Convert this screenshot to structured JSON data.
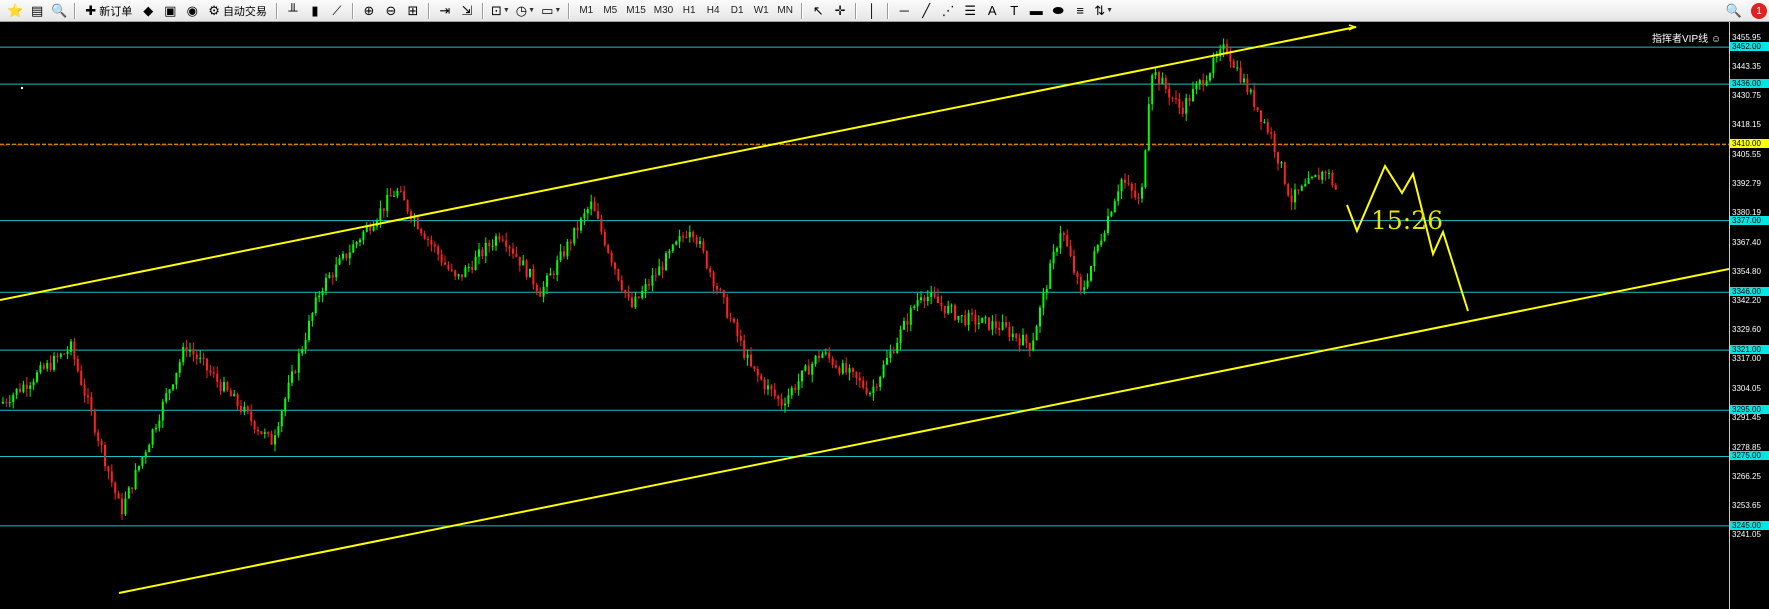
{
  "toolbar": {
    "new_order": "新订单",
    "auto_trading": "自动交易",
    "timeframes": [
      "M1",
      "M5",
      "M15",
      "M30",
      "H1",
      "H4",
      "D1",
      "W1",
      "MN"
    ],
    "alert_count": "1"
  },
  "watermark": "指挥者VIP线",
  "countdown": "15:26",
  "price_axis": {
    "ticks": [
      3455.95,
      3443.35,
      3430.75,
      3418.15,
      3405.55,
      3392.79,
      3380.19,
      3367.4,
      3354.8,
      3342.2,
      3329.6,
      3317.0,
      3304.05,
      3291.45,
      3278.85,
      3266.25,
      3253.65,
      3241.05
    ],
    "tick_labels": [
      "3455.95",
      "3443.35",
      "3430.75",
      "3418.15",
      "3405.55",
      "3392.79",
      "3380.19",
      "3367.40",
      "3354.80",
      "3342.20",
      "3329.60",
      "3317.00",
      "3304.05",
      "3291.45",
      "3278.85",
      "3266.25",
      "3253.65",
      "3241.05"
    ],
    "levels": [
      {
        "value": 3452.0,
        "label": "3452.00",
        "color": "#00e5e5"
      },
      {
        "value": 3436.0,
        "label": "3436.00",
        "color": "#00e5e5"
      },
      {
        "value": 3410.0,
        "label": "3410.00",
        "color": "#ffff00"
      },
      {
        "value": 3377.0,
        "label": "3377.00",
        "color": "#00e5e5"
      },
      {
        "value": 3346.0,
        "label": "3346.00",
        "color": "#00e5e5"
      },
      {
        "value": 3321.0,
        "label": "3321.00",
        "color": "#00e5e5"
      },
      {
        "value": 3295.0,
        "label": "3295.00",
        "color": "#00e5e5"
      },
      {
        "value": 3275.0,
        "label": "3275.00",
        "color": "#00e5e5"
      },
      {
        "value": 3245.0,
        "label": "3245.00",
        "color": "#00e5e5"
      }
    ]
  },
  "colors": {
    "background": "#000000",
    "bull": "#00ff00",
    "bear": "#ff2020",
    "level_line": "#1fbfbf",
    "trend_line": "#ffff00",
    "dashdot_line": "#b22222"
  }
}
